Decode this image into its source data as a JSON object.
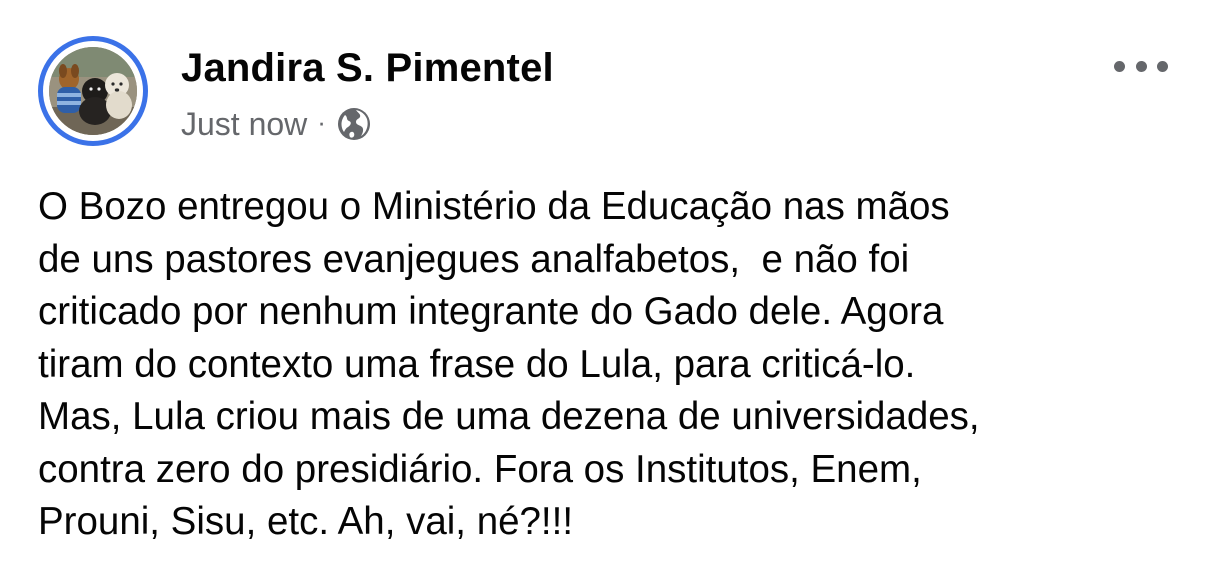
{
  "post": {
    "author": "Jandira S. Pimentel",
    "timestamp": "Just now",
    "separator": "·",
    "privacy_icon": "globe-icon",
    "more_icon": "more-options-icon",
    "avatar_ring_color": "#3b72e8",
    "text_lines": [
      "O Bozo entregou o Ministério da Educação nas mãos",
      "de uns pastores evanjegues analfabetos,  e não foi",
      "criticado por nenhum integrante do Gado dele. Agora",
      "tiram do contexto uma frase do Lula, para criticá-lo.",
      "Mas, Lula criou mais de uma dezena de universidades,",
      "contra zero do presidiário. Fora os Institutos, Enem,",
      "Prouni, Sisu, etc. Ah, vai, né?!!!"
    ]
  }
}
